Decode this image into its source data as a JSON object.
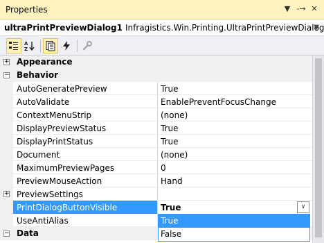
{
  "window": {
    "title": "Properties",
    "pin_icon": "-→",
    "float_icon": "▼",
    "close_icon": "✕"
  },
  "object_selector": {
    "name": "ultraPrintPreviewDialog1",
    "type": "Infragistics.Win.Printing.UltraPrintPreviewDialog",
    "dropdown_icon": "▼"
  },
  "toolbar": {
    "buttons": [
      {
        "icon": "categorized-icon",
        "active": true
      },
      {
        "icon": "alphabetical-icon",
        "active": false
      },
      {
        "icon": "properties-icon",
        "active": true
      },
      {
        "icon": "events-icon",
        "active": false
      },
      {
        "icon": "property-pages-icon",
        "active": false
      }
    ]
  },
  "grid": {
    "categories": {
      "appearance": {
        "name": "Appearance",
        "state": "+"
      },
      "behavior": {
        "name": "Behavior",
        "state": "−"
      },
      "data": {
        "name": "Data",
        "state": "−"
      }
    },
    "properties": [
      {
        "name": "AutoGeneratePreview",
        "value": "True"
      },
      {
        "name": "AutoValidate",
        "value": "EnablePreventFocusChange"
      },
      {
        "name": "ContextMenuStrip",
        "value": "(none)"
      },
      {
        "name": "DisplayPreviewStatus",
        "value": "True"
      },
      {
        "name": "DisplayPrintStatus",
        "value": "True"
      },
      {
        "name": "Document",
        "value": "(none)"
      },
      {
        "name": "MaximumPreviewPages",
        "value": "0"
      },
      {
        "name": "PreviewMouseAction",
        "value": "Hand"
      },
      {
        "name": "PreviewSettings",
        "value": "",
        "expander": "+"
      },
      {
        "name": "PrintDialogButtonVisible",
        "value": "True",
        "selected": true
      },
      {
        "name": "UseAntiAlias",
        "value": ""
      }
    ]
  },
  "dropdown": {
    "options": [
      "True",
      "False"
    ],
    "selected": "True",
    "button_icon": "∨"
  },
  "colors": {
    "title_bg": "#fff4c0",
    "selection": "#3399ff",
    "category_bg": "#f0f0f0"
  }
}
